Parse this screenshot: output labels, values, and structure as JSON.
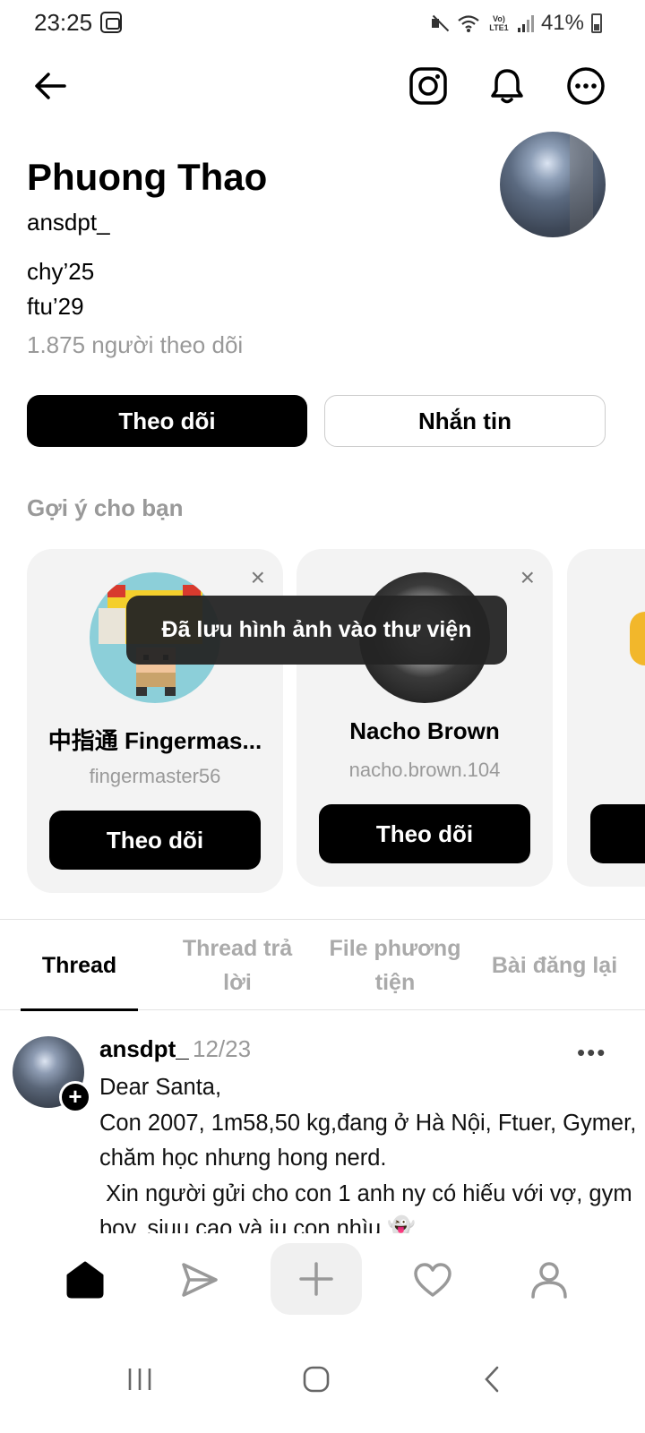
{
  "status_bar": {
    "time": "23:25",
    "lte_label": "Vo)\nLTE1",
    "battery": "41%"
  },
  "profile": {
    "name": "Phuong Thao",
    "handle": "ansdpt_",
    "bio": [
      "chy’25",
      "ftu’29"
    ],
    "followers": "1.875 người theo dõi",
    "follow_label": "Theo dõi",
    "message_label": "Nhắn tin"
  },
  "suggestions": {
    "title": "Gợi ý cho bạn",
    "cards": [
      {
        "name": "中指通 Fingermas...",
        "handle": "fingermaster56",
        "button": "Theo dõi",
        "close": "×"
      },
      {
        "name": "Nacho Brown",
        "handle": "nacho.brown.104",
        "button": "Theo dõi",
        "close": "×"
      }
    ]
  },
  "toast": "Đã lưu hình ảnh vào thư viện",
  "tabs": [
    {
      "label": "Thread",
      "active": true
    },
    {
      "label": "Thread trả lời",
      "active": false
    },
    {
      "label": "File phương tiện",
      "active": false
    },
    {
      "label": "Bài đăng lại",
      "active": false
    }
  ],
  "post": {
    "user": "ansdpt_",
    "date": "12/23",
    "more": "•••",
    "plus": "+",
    "text": "Dear Santa,\nCon 2007, 1m58,50 kg,đang ở Hà Nội, Ftuer, Gymer, chăm học nhưng hong nerd.\n Xin người gửi cho con 1 anh ny có hiếu với vợ, gym boy, siuu cao và iu con nhìu 👻"
  },
  "icons": {
    "back": "arrow-left-icon",
    "instagram": "instagram-icon",
    "notifications": "bell-icon",
    "more": "more-circle-icon",
    "home": "home-icon",
    "send": "send-icon",
    "compose": "plus-icon",
    "activity": "heart-icon",
    "profile": "person-icon"
  },
  "colors": {
    "primary": "#000000",
    "muted": "#999999",
    "card_bg": "#f3f3f3",
    "toast_bg": "#242424"
  }
}
